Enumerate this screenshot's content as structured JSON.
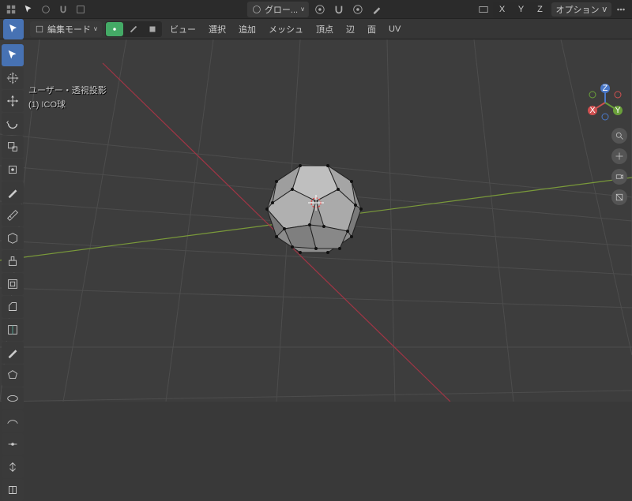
{
  "topbar": {
    "snap_label": "グロー...",
    "axis_labels": [
      "X",
      "Y",
      "Z"
    ],
    "options_label": "オプション"
  },
  "secondbar": {
    "mode_label": "編集モード",
    "menus": [
      "ビュー",
      "選択",
      "追加",
      "メッシュ",
      "頂点",
      "辺",
      "面",
      "UV"
    ]
  },
  "overlay": {
    "line1": "ユーザー・透視投影",
    "line2": "(1) ICO球"
  },
  "gizmo": {
    "x": "X",
    "y": "Y",
    "z": "Z"
  }
}
